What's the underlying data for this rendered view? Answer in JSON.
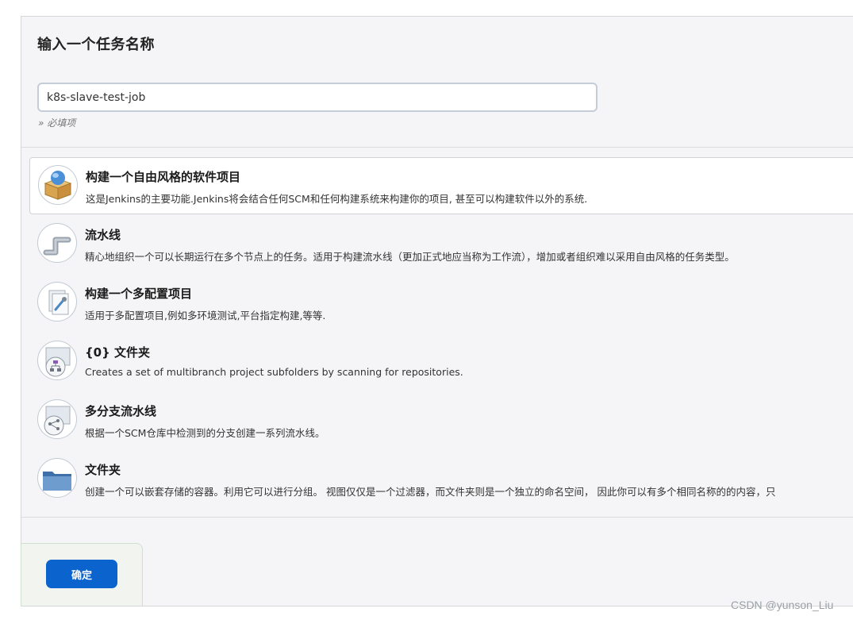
{
  "form": {
    "heading": "输入一个任务名称",
    "job_name_value": "k8s-slave-test-job",
    "required_hint": "» 必填项"
  },
  "item_types": [
    {
      "title": "构建一个自由风格的软件项目",
      "description": "这是Jenkins的主要功能.Jenkins将会结合任何SCM和任何构建系统来构建你的项目, 甚至可以构建软件以外的系统.",
      "icon": "freestyle-package-icon",
      "selected": true
    },
    {
      "title": "流水线",
      "description": "精心地组织一个可以长期运行在多个节点上的任务。适用于构建流水线（更加正式地应当称为工作流），增加或者组织难以采用自由风格的任务类型。",
      "icon": "pipeline-icon",
      "selected": false
    },
    {
      "title": "构建一个多配置项目",
      "description": "适用于多配置项目,例如多环境测试,平台指定构建,等等.",
      "icon": "multi-config-icon",
      "selected": false
    },
    {
      "title": "{0} 文件夹",
      "description": "Creates a set of multibranch project subfolders by scanning for repositories.",
      "icon": "organization-folder-icon",
      "selected": false
    },
    {
      "title": "多分支流水线",
      "description": "根据一个SCM仓库中检测到的分支创建一系列流水线。",
      "icon": "multibranch-pipeline-icon",
      "selected": false
    },
    {
      "title": "文件夹",
      "description": "创建一个可以嵌套存储的容器。利用它可以进行分组。 视图仅仅是一个过滤器，而文件夹则是一个独立的命名空间， 因此你可以有多个相同名称的的内容，只",
      "icon": "folder-icon",
      "selected": false
    }
  ],
  "actions": {
    "ok_label": "确定"
  },
  "watermark": "CSDN @yunson_Liu",
  "colors": {
    "primary_button": "#0b63ce",
    "panel_background": "#f5f5f7"
  }
}
